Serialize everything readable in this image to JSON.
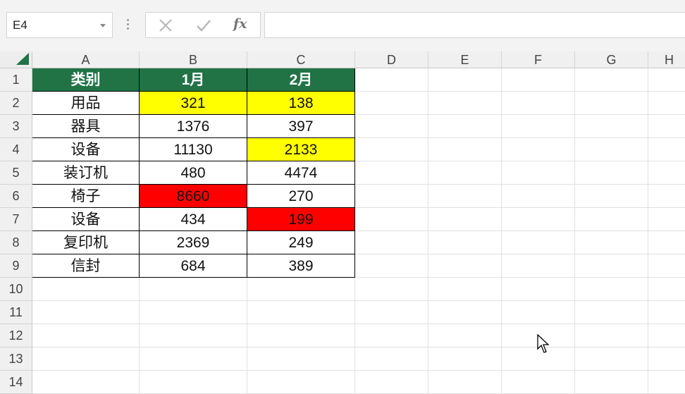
{
  "formula_bar": {
    "name_box": "E4",
    "fx_label": "fx",
    "formula_value": ""
  },
  "columns": [
    "A",
    "B",
    "C",
    "D",
    "E",
    "F",
    "G",
    "H"
  ],
  "rows": [
    "1",
    "2",
    "3",
    "4",
    "5",
    "6",
    "7",
    "8",
    "9",
    "10",
    "11",
    "12",
    "13",
    "14"
  ],
  "table": {
    "header": [
      "类别",
      "1月",
      "2月"
    ],
    "rows": [
      [
        "用品",
        "321",
        "138"
      ],
      [
        "器具",
        "1376",
        "397"
      ],
      [
        "设备",
        "11130",
        "2133"
      ],
      [
        "装订机",
        "480",
        "4474"
      ],
      [
        "椅子",
        "8660",
        "270"
      ],
      [
        "设备",
        "434",
        "199"
      ],
      [
        "复印机",
        "2369",
        "249"
      ],
      [
        "信封",
        "684",
        "389"
      ]
    ],
    "highlights": {
      "yellow": [
        "B2",
        "C2",
        "C4"
      ],
      "red": [
        "B6",
        "C7"
      ]
    }
  },
  "colors": {
    "header_fill": "#217346",
    "highlight_yellow": "#ffff00",
    "highlight_red": "#ff0000"
  }
}
